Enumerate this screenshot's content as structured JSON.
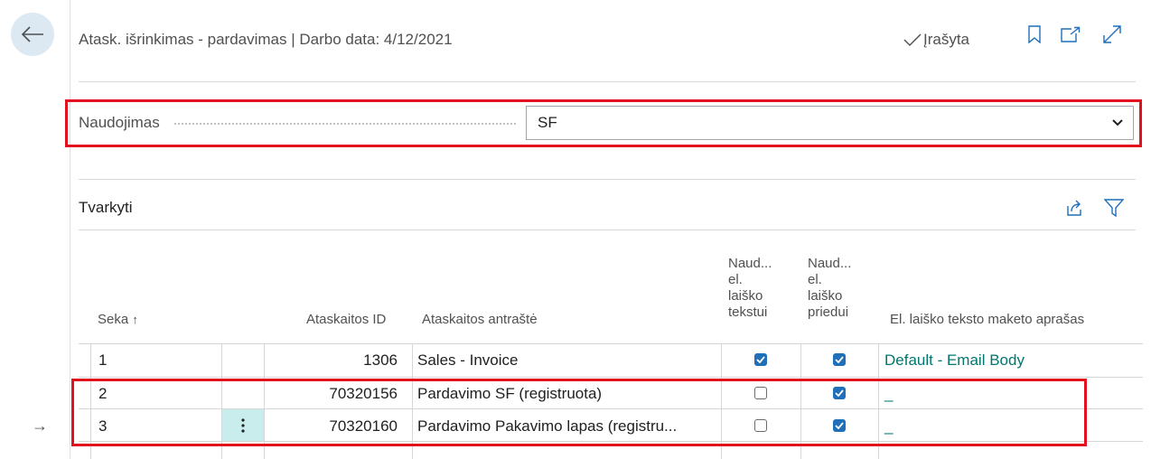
{
  "header": {
    "title": "Atask. išrinkimas - pardavimas | Darbo data: 4/12/2021",
    "saved_label": "Įrašyta"
  },
  "usage": {
    "label": "Naudojimas",
    "value": "SF"
  },
  "section": {
    "title": "Tvarkyti"
  },
  "table": {
    "columns": {
      "seq": "Seka",
      "report_id": "Ataskaitos ID",
      "report_caption": "Ataskaitos antraštė",
      "use_email_body_1": "Naud...",
      "use_email_body_2": "el.",
      "use_email_body_3": "laiško",
      "use_email_body_4": "tekstui",
      "use_email_attach_1": "Naud...",
      "use_email_attach_2": "el.",
      "use_email_attach_3": "laiško",
      "use_email_attach_4": "priedui",
      "email_layout": "El. laiško teksto maketo aprašas"
    },
    "rows": [
      {
        "seq": "1",
        "report_id": "1306",
        "caption": "Sales - Invoice",
        "email_body": true,
        "email_attach": true,
        "layout": "Default - Email Body"
      },
      {
        "seq": "2",
        "report_id": "70320156",
        "caption": "Pardavimo SF (registruota)",
        "email_body": false,
        "email_attach": true,
        "layout": "_"
      },
      {
        "seq": "3",
        "report_id": "70320160",
        "caption": "Pardavimo Pakavimo lapas (registru...",
        "email_body": false,
        "email_attach": true,
        "layout": "_"
      }
    ]
  },
  "colors": {
    "accent": "#1f6fb9",
    "highlight": "#e3101d",
    "link": "#00776f"
  }
}
